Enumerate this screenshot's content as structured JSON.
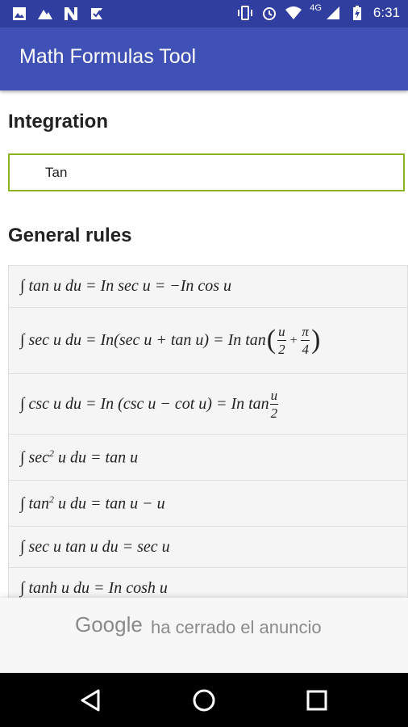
{
  "status_bar": {
    "time": "6:31",
    "network_label": "4G",
    "icons_left": [
      "image-icon",
      "mountain-icon",
      "n-icon",
      "check-icon"
    ],
    "icons_right": [
      "vibrate-icon",
      "alarm-icon",
      "wifi-icon",
      "signal-icon",
      "battery-icon"
    ]
  },
  "app_bar": {
    "title": "Math Formulas Tool"
  },
  "integration": {
    "heading": "Integration"
  },
  "search": {
    "value": "Tan",
    "accent": "#8bb31f"
  },
  "general_rules": {
    "heading": "General rules",
    "formulas": [
      {
        "text": "∫ tan u du = In sec u = −In cos u"
      },
      {
        "prefix": "∫ sec u du = In(sec u + tan u) = In tan",
        "frac1_num": "u",
        "frac1_den": "2",
        "plus": "+",
        "frac2_num": "π",
        "frac2_den": "4",
        "open": "(",
        "close": ")"
      },
      {
        "prefix": "∫ csc u du = In (csc u − cot u) = In tan",
        "frac_num": "u",
        "frac_den": "2"
      },
      {
        "before": "∫ sec",
        "sup": "2",
        "after": " u du = tan u"
      },
      {
        "before": "∫ tan",
        "sup": "2",
        "after": " u du = tan u − u"
      },
      {
        "text": "∫ sec u tan u du = sec u"
      },
      {
        "text": "∫ tanh u du = In cosh u"
      }
    ]
  },
  "ad": {
    "brand": "Google",
    "message": "ha cerrado el anuncio"
  },
  "nav_bar": {
    "buttons": [
      "back-icon",
      "home-icon",
      "recents-icon"
    ]
  },
  "colors": {
    "status_bar": "#303f9f",
    "app_bar": "#3f51b5",
    "row_bg": "#f5f5f5"
  }
}
